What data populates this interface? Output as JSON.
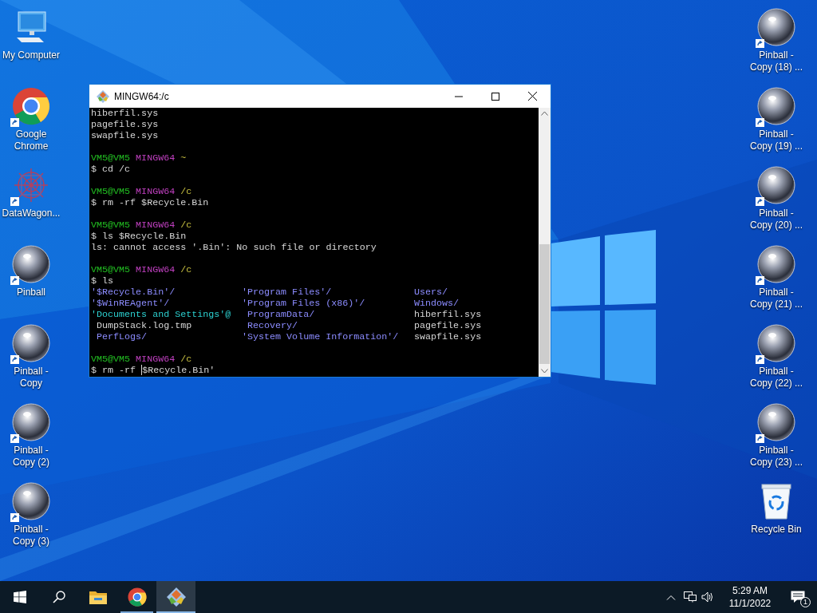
{
  "desktop_left": [
    {
      "label": "My Computer",
      "kind": "computer",
      "shortcut": false
    },
    {
      "label": "Google Chrome",
      "kind": "chrome",
      "shortcut": true
    },
    {
      "label": "DataWagon...",
      "kind": "datawagon",
      "shortcut": true
    },
    {
      "label": "Pinball",
      "kind": "pinball",
      "shortcut": true
    },
    {
      "label": "Pinball - Copy",
      "kind": "pinball",
      "shortcut": true
    },
    {
      "label": "Pinball - Copy (2)",
      "kind": "pinball",
      "shortcut": true
    },
    {
      "label": "Pinball - Copy (3)",
      "kind": "pinball",
      "shortcut": true
    }
  ],
  "desktop_right": [
    {
      "label": "Pinball - Copy (18) ...",
      "kind": "pinball",
      "shortcut": true
    },
    {
      "label": "Pinball - Copy (19) ...",
      "kind": "pinball",
      "shortcut": true
    },
    {
      "label": "Pinball - Copy (20) ...",
      "kind": "pinball",
      "shortcut": true
    },
    {
      "label": "Pinball - Copy (21) ...",
      "kind": "pinball",
      "shortcut": true
    },
    {
      "label": "Pinball - Copy (22) ...",
      "kind": "pinball",
      "shortcut": true
    },
    {
      "label": "Pinball - Copy (23) ...",
      "kind": "pinball",
      "shortcut": true
    },
    {
      "label": "Recycle Bin",
      "kind": "recycle",
      "shortcut": false
    }
  ],
  "window": {
    "title": "MINGW64:/c",
    "lines": [
      {
        "kind": "text",
        "text": "hiberfil.sys"
      },
      {
        "kind": "text",
        "text": "pagefile.sys"
      },
      {
        "kind": "text",
        "text": "swapfile.sys"
      },
      {
        "kind": "blank"
      },
      {
        "kind": "prompt",
        "user": "VM5@VM5",
        "host": "MINGW64",
        "path": "~"
      },
      {
        "kind": "text",
        "text": "$ cd /c"
      },
      {
        "kind": "blank"
      },
      {
        "kind": "prompt",
        "user": "VM5@VM5",
        "host": "MINGW64",
        "path": "/c"
      },
      {
        "kind": "text",
        "text": "$ rm -rf $Recycle.Bin"
      },
      {
        "kind": "blank"
      },
      {
        "kind": "prompt",
        "user": "VM5@VM5",
        "host": "MINGW64",
        "path": "/c"
      },
      {
        "kind": "text",
        "text": "$ ls $Recycle.Bin"
      },
      {
        "kind": "text",
        "text": "ls: cannot access '.Bin': No such file or directory"
      },
      {
        "kind": "blank"
      },
      {
        "kind": "prompt",
        "user": "VM5@VM5",
        "host": "MINGW64",
        "path": "/c"
      },
      {
        "kind": "text",
        "text": "$ ls"
      },
      {
        "kind": "listing",
        "cells": [
          {
            "text": "'$Recycle.Bin'/",
            "kind": "dir"
          },
          {
            "text": "'Program Files'/",
            "kind": "dir"
          },
          {
            "text": "Users/",
            "kind": "dir"
          }
        ]
      },
      {
        "kind": "listing",
        "cells": [
          {
            "text": "'$WinREAgent'/",
            "kind": "dir"
          },
          {
            "text": "'Program Files (x86)'/",
            "kind": "dir"
          },
          {
            "text": "Windows/",
            "kind": "dir"
          }
        ]
      },
      {
        "kind": "listing",
        "cells": [
          {
            "text": "'Documents and Settings'@",
            "kind": "link"
          },
          {
            "text": " ProgramData/",
            "kind": "dir"
          },
          {
            "text": "hiberfil.sys",
            "kind": "file"
          }
        ]
      },
      {
        "kind": "listing",
        "cells": [
          {
            "text": " DumpStack.log.tmp",
            "kind": "file"
          },
          {
            "text": " Recovery/",
            "kind": "dir"
          },
          {
            "text": "pagefile.sys",
            "kind": "file"
          }
        ]
      },
      {
        "kind": "listing",
        "cells": [
          {
            "text": " PerfLogs/",
            "kind": "dir"
          },
          {
            "text": "'System Volume Information'/",
            "kind": "dir"
          },
          {
            "text": "swapfile.sys",
            "kind": "file"
          }
        ]
      },
      {
        "kind": "blank"
      },
      {
        "kind": "prompt",
        "user": "VM5@VM5",
        "host": "MINGW64",
        "path": "/c"
      },
      {
        "kind": "input",
        "text": "$ rm -rf ",
        "rest": "$Recycle.Bin'"
      }
    ]
  },
  "taskbar": {
    "apps": [
      {
        "kind": "start",
        "running": false,
        "selected": false
      },
      {
        "kind": "search",
        "running": false,
        "selected": false
      },
      {
        "kind": "explorer",
        "running": false,
        "selected": false
      },
      {
        "kind": "chrome",
        "running": true,
        "selected": false
      },
      {
        "kind": "git",
        "running": true,
        "selected": true
      }
    ],
    "time": "5:29 AM",
    "date": "11/1/2022",
    "notifications": "1"
  }
}
